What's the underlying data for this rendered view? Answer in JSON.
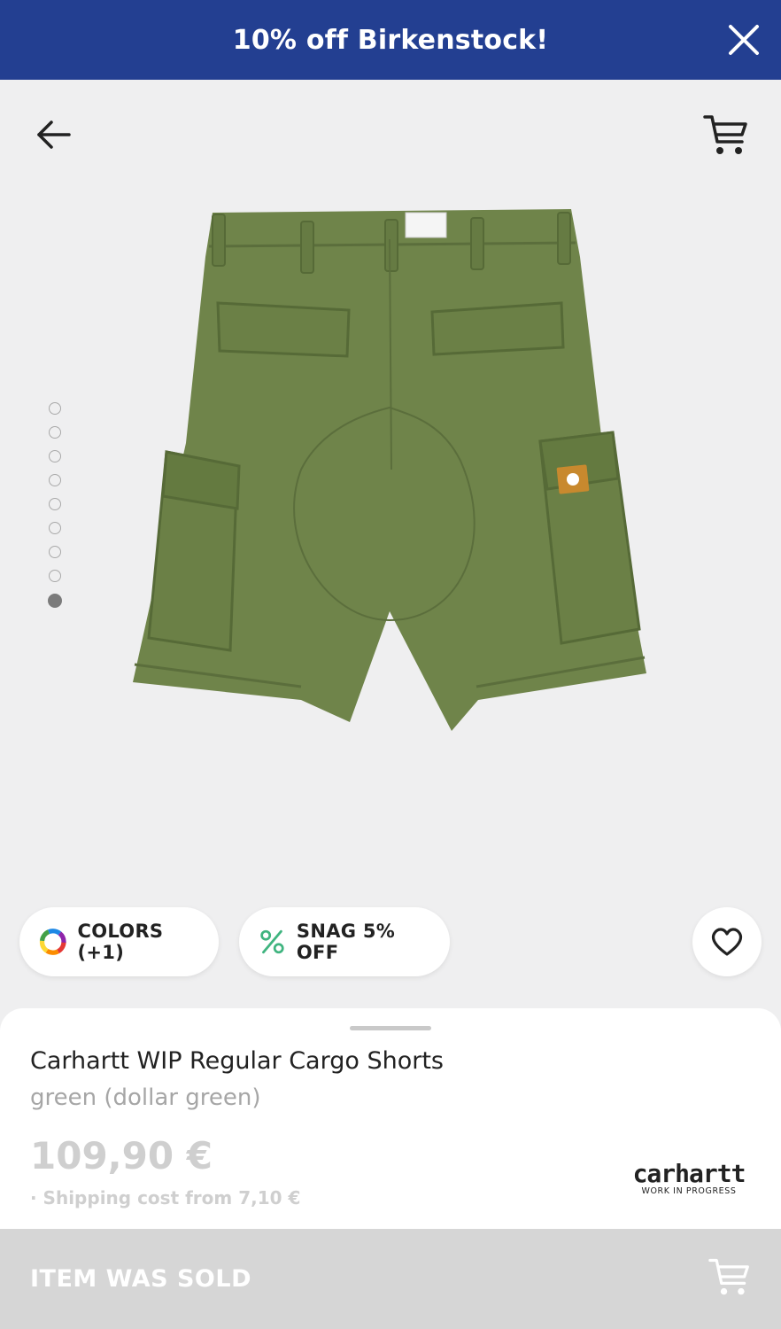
{
  "promo": {
    "text": "10% off Birkenstock!",
    "close_icon": "close-icon"
  },
  "gallery": {
    "total_images": 9,
    "active_index": 8,
    "image_alt": "Carhartt WIP Regular Cargo Shorts, back view, green"
  },
  "actions": {
    "colors_label": "COLORS (+1)",
    "snag_label": "SNAG 5% OFF"
  },
  "product": {
    "title": "Carhartt WIP Regular Cargo Shorts",
    "color": "green (dollar green)",
    "price": "109,90 €",
    "shipping": "· Shipping cost from 7,10 €",
    "brand_name": "carhartt",
    "brand_tagline": "WORK IN PROGRESS"
  },
  "footer": {
    "status_label": "ITEM WAS SOLD"
  },
  "colors": {
    "banner": "#233f91",
    "short_green": "#6f844a",
    "sold_bar": "#d6d6d6",
    "snag_accent": "#3fb47f"
  }
}
